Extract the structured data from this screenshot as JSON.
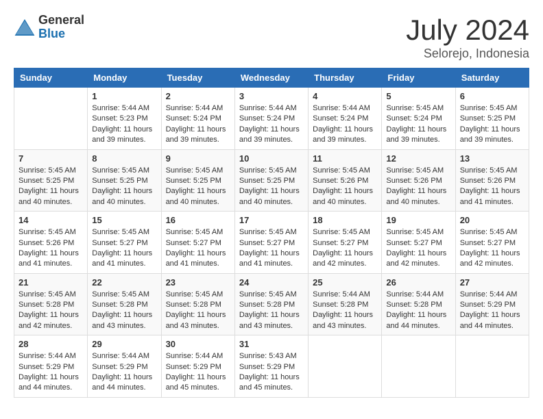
{
  "logo": {
    "general": "General",
    "blue": "Blue"
  },
  "title": "July 2024",
  "location": "Selorejo, Indonesia",
  "days_of_week": [
    "Sunday",
    "Monday",
    "Tuesday",
    "Wednesday",
    "Thursday",
    "Friday",
    "Saturday"
  ],
  "weeks": [
    [
      {
        "day": "",
        "info": ""
      },
      {
        "day": "1",
        "info": "Sunrise: 5:44 AM\nSunset: 5:23 PM\nDaylight: 11 hours\nand 39 minutes."
      },
      {
        "day": "2",
        "info": "Sunrise: 5:44 AM\nSunset: 5:24 PM\nDaylight: 11 hours\nand 39 minutes."
      },
      {
        "day": "3",
        "info": "Sunrise: 5:44 AM\nSunset: 5:24 PM\nDaylight: 11 hours\nand 39 minutes."
      },
      {
        "day": "4",
        "info": "Sunrise: 5:44 AM\nSunset: 5:24 PM\nDaylight: 11 hours\nand 39 minutes."
      },
      {
        "day": "5",
        "info": "Sunrise: 5:45 AM\nSunset: 5:24 PM\nDaylight: 11 hours\nand 39 minutes."
      },
      {
        "day": "6",
        "info": "Sunrise: 5:45 AM\nSunset: 5:25 PM\nDaylight: 11 hours\nand 39 minutes."
      }
    ],
    [
      {
        "day": "7",
        "info": "Sunrise: 5:45 AM\nSunset: 5:25 PM\nDaylight: 11 hours\nand 40 minutes."
      },
      {
        "day": "8",
        "info": "Sunrise: 5:45 AM\nSunset: 5:25 PM\nDaylight: 11 hours\nand 40 minutes."
      },
      {
        "day": "9",
        "info": "Sunrise: 5:45 AM\nSunset: 5:25 PM\nDaylight: 11 hours\nand 40 minutes."
      },
      {
        "day": "10",
        "info": "Sunrise: 5:45 AM\nSunset: 5:25 PM\nDaylight: 11 hours\nand 40 minutes."
      },
      {
        "day": "11",
        "info": "Sunrise: 5:45 AM\nSunset: 5:26 PM\nDaylight: 11 hours\nand 40 minutes."
      },
      {
        "day": "12",
        "info": "Sunrise: 5:45 AM\nSunset: 5:26 PM\nDaylight: 11 hours\nand 40 minutes."
      },
      {
        "day": "13",
        "info": "Sunrise: 5:45 AM\nSunset: 5:26 PM\nDaylight: 11 hours\nand 41 minutes."
      }
    ],
    [
      {
        "day": "14",
        "info": "Sunrise: 5:45 AM\nSunset: 5:26 PM\nDaylight: 11 hours\nand 41 minutes."
      },
      {
        "day": "15",
        "info": "Sunrise: 5:45 AM\nSunset: 5:27 PM\nDaylight: 11 hours\nand 41 minutes."
      },
      {
        "day": "16",
        "info": "Sunrise: 5:45 AM\nSunset: 5:27 PM\nDaylight: 11 hours\nand 41 minutes."
      },
      {
        "day": "17",
        "info": "Sunrise: 5:45 AM\nSunset: 5:27 PM\nDaylight: 11 hours\nand 41 minutes."
      },
      {
        "day": "18",
        "info": "Sunrise: 5:45 AM\nSunset: 5:27 PM\nDaylight: 11 hours\nand 42 minutes."
      },
      {
        "day": "19",
        "info": "Sunrise: 5:45 AM\nSunset: 5:27 PM\nDaylight: 11 hours\nand 42 minutes."
      },
      {
        "day": "20",
        "info": "Sunrise: 5:45 AM\nSunset: 5:27 PM\nDaylight: 11 hours\nand 42 minutes."
      }
    ],
    [
      {
        "day": "21",
        "info": "Sunrise: 5:45 AM\nSunset: 5:28 PM\nDaylight: 11 hours\nand 42 minutes."
      },
      {
        "day": "22",
        "info": "Sunrise: 5:45 AM\nSunset: 5:28 PM\nDaylight: 11 hours\nand 43 minutes."
      },
      {
        "day": "23",
        "info": "Sunrise: 5:45 AM\nSunset: 5:28 PM\nDaylight: 11 hours\nand 43 minutes."
      },
      {
        "day": "24",
        "info": "Sunrise: 5:45 AM\nSunset: 5:28 PM\nDaylight: 11 hours\nand 43 minutes."
      },
      {
        "day": "25",
        "info": "Sunrise: 5:44 AM\nSunset: 5:28 PM\nDaylight: 11 hours\nand 43 minutes."
      },
      {
        "day": "26",
        "info": "Sunrise: 5:44 AM\nSunset: 5:28 PM\nDaylight: 11 hours\nand 44 minutes."
      },
      {
        "day": "27",
        "info": "Sunrise: 5:44 AM\nSunset: 5:29 PM\nDaylight: 11 hours\nand 44 minutes."
      }
    ],
    [
      {
        "day": "28",
        "info": "Sunrise: 5:44 AM\nSunset: 5:29 PM\nDaylight: 11 hours\nand 44 minutes."
      },
      {
        "day": "29",
        "info": "Sunrise: 5:44 AM\nSunset: 5:29 PM\nDaylight: 11 hours\nand 44 minutes."
      },
      {
        "day": "30",
        "info": "Sunrise: 5:44 AM\nSunset: 5:29 PM\nDaylight: 11 hours\nand 45 minutes."
      },
      {
        "day": "31",
        "info": "Sunrise: 5:43 AM\nSunset: 5:29 PM\nDaylight: 11 hours\nand 45 minutes."
      },
      {
        "day": "",
        "info": ""
      },
      {
        "day": "",
        "info": ""
      },
      {
        "day": "",
        "info": ""
      }
    ]
  ]
}
